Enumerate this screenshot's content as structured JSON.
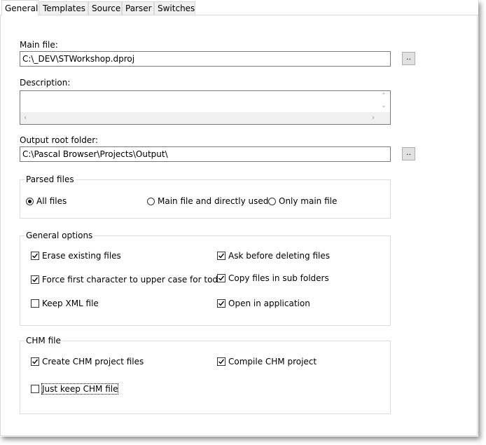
{
  "tabs": [
    "General",
    "Templates",
    "Source",
    "Parser",
    "Switches"
  ],
  "main_file": {
    "label": "Main file:",
    "value": "C:\\_DEV\\STWorkshop.dproj",
    "browse": ".."
  },
  "description": {
    "label": "Description:",
    "value": ""
  },
  "output_root": {
    "label": "Output root folder:",
    "value": "C:\\Pascal Browser\\Projects\\Output\\",
    "browse": ".."
  },
  "parsed_files": {
    "title": "Parsed files",
    "options": [
      {
        "label": "All files",
        "selected": true
      },
      {
        "label": "Main file and directly used",
        "selected": false
      },
      {
        "label": "Only main file",
        "selected": false
      }
    ]
  },
  "general_options": {
    "title": "General options",
    "items": [
      {
        "label": "Erase existing files",
        "checked": true
      },
      {
        "label": "Ask before deleting files",
        "checked": true
      },
      {
        "label": "Force first character to upper case for todo",
        "checked": true
      },
      {
        "label": "Copy files in sub folders",
        "checked": true
      },
      {
        "label": "Keep XML file",
        "checked": false
      },
      {
        "label": "Open in application",
        "checked": true
      }
    ]
  },
  "chm_file": {
    "title": "CHM file",
    "items": [
      {
        "label": "Create CHM project files",
        "checked": true
      },
      {
        "label": "Compile CHM project",
        "checked": true
      },
      {
        "label": "Just keep CHM file",
        "checked": false
      }
    ]
  }
}
